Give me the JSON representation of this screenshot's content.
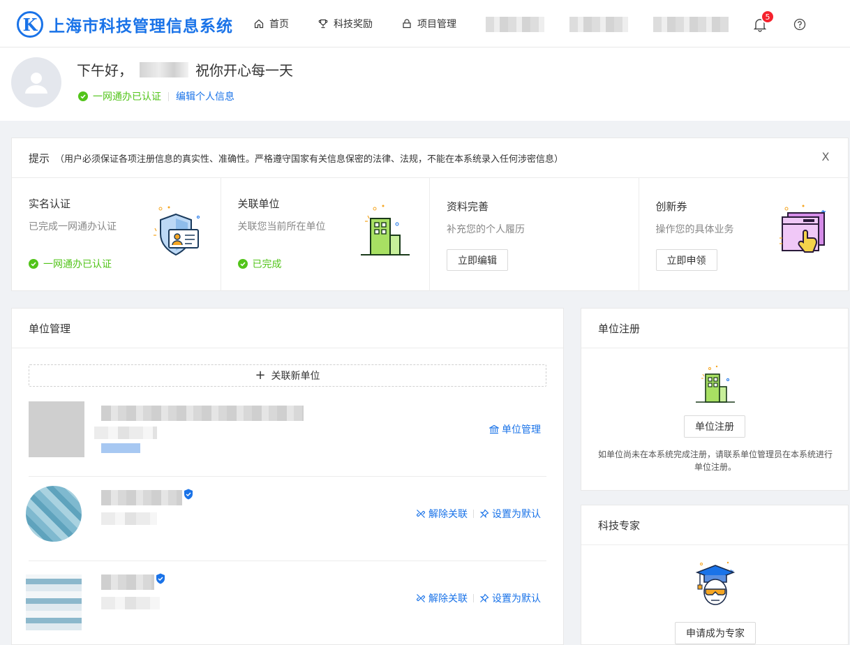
{
  "header": {
    "logo_letter": "K",
    "title": "上海市科技管理信息系统",
    "nav": [
      {
        "label": "首页",
        "icon": "home-icon"
      },
      {
        "label": "科技奖励",
        "icon": "trophy-icon"
      },
      {
        "label": "项目管理",
        "icon": "lock-icon"
      }
    ],
    "notification_count": "5"
  },
  "greeting": {
    "prefix": "下午好，",
    "suffix": "祝你开心每一天",
    "cert_status": "一网通办已认证",
    "edit_link": "编辑个人信息"
  },
  "tip": {
    "title": "提示",
    "desc": "（用户必须保证各项注册信息的真实性、准确性。严格遵守国家有关信息保密的法律、法规，不能在本系统录入任何涉密信息）",
    "close": "X",
    "cards": [
      {
        "title": "实名认证",
        "desc": "已完成一网通办认证",
        "status": "一网通办已认证"
      },
      {
        "title": "关联单位",
        "desc": "关联您当前所在单位",
        "status": "已完成"
      },
      {
        "title": "资料完善",
        "desc": "补充您的个人履历",
        "button": "立即编辑"
      },
      {
        "title": "创新券",
        "desc": "操作您的具体业务",
        "button": "立即申领"
      }
    ]
  },
  "unit_management": {
    "title": "单位管理",
    "add_label": "关联新单位",
    "rows": [
      {
        "actions": [
          "单位管理"
        ]
      },
      {
        "actions": [
          "解除关联",
          "设置为默认"
        ]
      },
      {
        "actions": [
          "解除关联",
          "设置为默认"
        ]
      }
    ]
  },
  "unit_register": {
    "title": "单位注册",
    "button": "单位注册",
    "note": "如单位尚未在本系统完成注册，请联系单位管理员在本系统进行单位注册。"
  },
  "expert": {
    "title": "科技专家",
    "button": "申请成为专家"
  },
  "colors": {
    "brand": "#1a73e8",
    "success": "#52c41a",
    "badge": "#f5222d"
  }
}
